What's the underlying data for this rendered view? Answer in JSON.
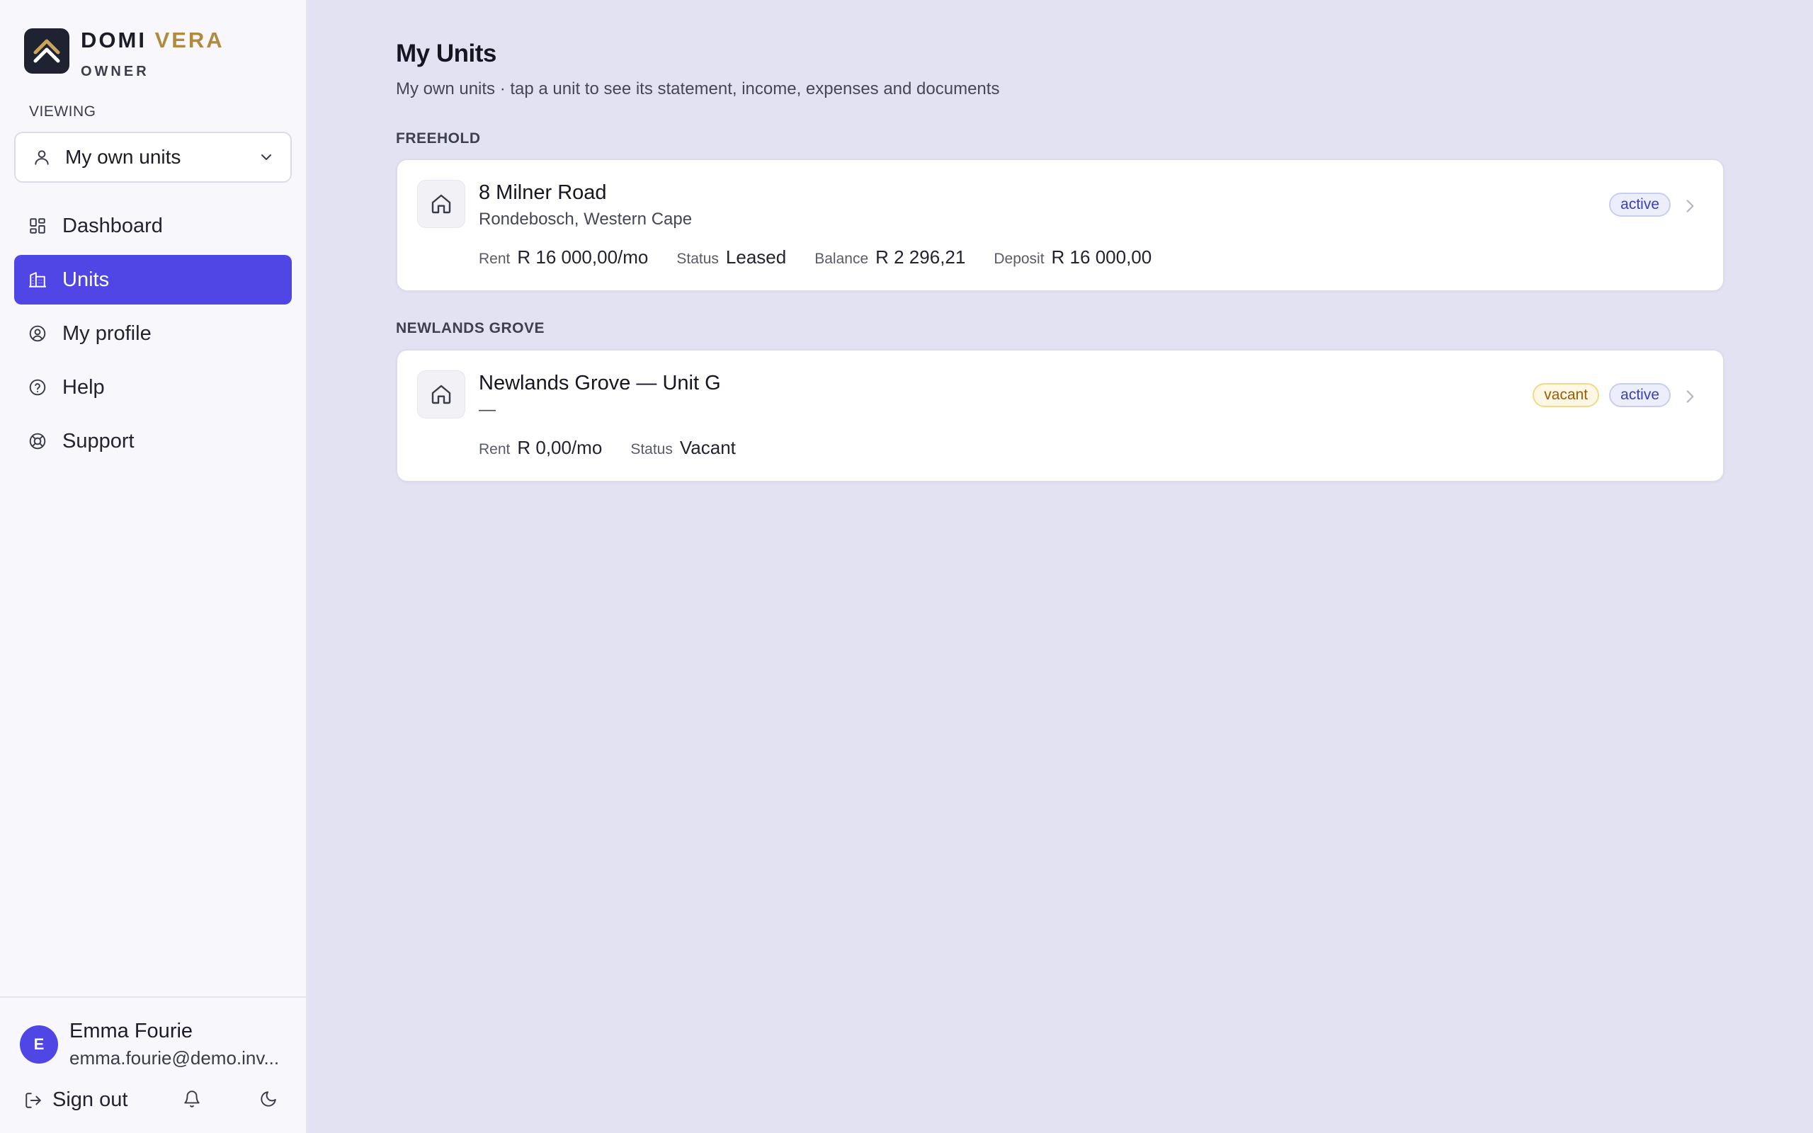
{
  "brand": {
    "name_part1": "DOMI",
    "name_part2": "VERA",
    "role": "OWNER"
  },
  "viewing": {
    "label": "VIEWING",
    "selected": "My own units"
  },
  "nav": [
    {
      "label": "Dashboard",
      "icon": "dashboard-icon",
      "active": false
    },
    {
      "label": "Units",
      "icon": "building-icon",
      "active": true
    },
    {
      "label": "My profile",
      "icon": "user-circle-icon",
      "active": false
    },
    {
      "label": "Help",
      "icon": "help-circle-icon",
      "active": false
    },
    {
      "label": "Support",
      "icon": "lifebuoy-icon",
      "active": false
    }
  ],
  "user": {
    "initial": "E",
    "name": "Emma Fourie",
    "email": "emma.fourie@demo.inv..."
  },
  "footer": {
    "sign_out": "Sign out"
  },
  "page": {
    "title": "My Units",
    "subtitle": "My own units · tap a unit to see its statement, income, expenses and documents"
  },
  "groups": [
    {
      "label": "FREEHOLD",
      "units": [
        {
          "title": "8 Milner Road",
          "subtitle": "Rondebosch, Western Cape",
          "badges": [
            {
              "text": "active",
              "kind": "active"
            }
          ],
          "metrics": [
            {
              "label": "Rent",
              "value": "R 16 000,00/mo"
            },
            {
              "label": "Status",
              "value": "Leased"
            },
            {
              "label": "Balance",
              "value": "R 2 296,21"
            },
            {
              "label": "Deposit",
              "value": "R 16 000,00"
            }
          ]
        }
      ]
    },
    {
      "label": "NEWLANDS GROVE",
      "units": [
        {
          "title": "Newlands Grove — Unit G",
          "subtitle": "—",
          "badges": [
            {
              "text": "vacant",
              "kind": "vacant"
            },
            {
              "text": "active",
              "kind": "active"
            }
          ],
          "metrics": [
            {
              "label": "Rent",
              "value": "R 0,00/mo"
            },
            {
              "label": "Status",
              "value": "Vacant"
            }
          ]
        }
      ]
    }
  ],
  "colors": {
    "accent": "#4f46e5",
    "brand_gold": "#b08a3e",
    "background": "#e3e2f3",
    "sidebar": "#f8f8fc"
  }
}
